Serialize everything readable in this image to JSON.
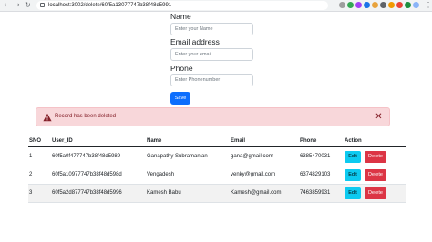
{
  "browser": {
    "url": "localhost:3002/delete/60f5a13077747b38f48d5991",
    "back_icon": "arrow-left",
    "forward_icon": "arrow-right",
    "reload_icon": "reload",
    "extension_colors": [
      "#9e9e9e",
      "#34a853",
      "#a142f4",
      "#1a73e8",
      "#e8a33d",
      "#5f6368",
      "#f29900",
      "#ea4335",
      "#1e8e3e",
      "#8ab4f8"
    ]
  },
  "form": {
    "name_label": "Name",
    "name_placeholder": "Enter your Name",
    "email_label": "Email address",
    "email_placeholder": "Enter your email",
    "phone_label": "Phone",
    "phone_placeholder": "Enter Phonenumber",
    "save_label": "Save"
  },
  "alert": {
    "message": "Record has been deleted",
    "icon": "warning-triangle",
    "close_icon": "close"
  },
  "table": {
    "headers": [
      "SNO",
      "User_ID",
      "Name",
      "Email",
      "Phone",
      "Action"
    ],
    "rows": [
      {
        "sno": "1",
        "user_id": "60f5a0f477747b38f48d5989",
        "name": "Ganapathy Subramanian",
        "email": "gana@gmail.com",
        "phone": "6385470031"
      },
      {
        "sno": "2",
        "user_id": "60f5a10977747b38f48d598d",
        "name": "Vengadesh",
        "email": "venky@gmail.com",
        "phone": "6374829103"
      },
      {
        "sno": "3",
        "user_id": "60f5a2d877747b38f48d5996",
        "name": "Kamesh Babu",
        "email": "Kamesh@gmail.com",
        "phone": "7463859931"
      }
    ],
    "edit_label": "Edit",
    "delete_label": "Delete"
  },
  "colors": {
    "primary": "#0d6efd",
    "info": "#0dcaf0",
    "danger": "#dc3545",
    "alert_bg": "#f8d7da",
    "alert_text": "#842029"
  }
}
